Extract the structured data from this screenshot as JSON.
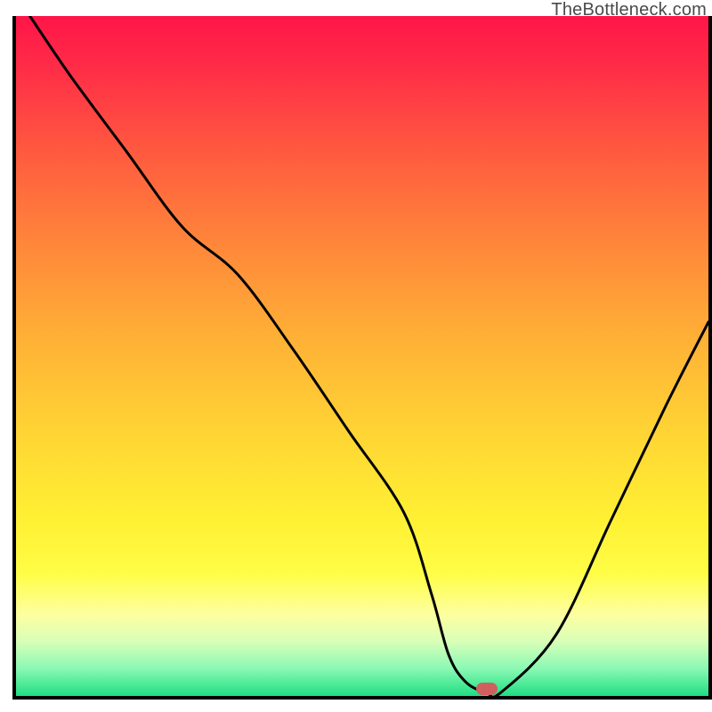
{
  "watermark": "TheBottleneck.com",
  "chart_data": {
    "type": "line",
    "title": "",
    "xlabel": "",
    "ylabel": "",
    "xlim": [
      0,
      100
    ],
    "ylim": [
      0,
      100
    ],
    "grid": false,
    "legend": false,
    "series": [
      {
        "name": "bottleneck-curve",
        "x": [
          2,
          8,
          16,
          24,
          32,
          40,
          48,
          56,
          60,
          62.5,
          65,
          68,
          70,
          78,
          86,
          94,
          100
        ],
        "y": [
          100,
          91,
          80,
          69,
          62,
          51,
          39,
          27,
          15,
          6,
          2,
          0.5,
          0.5,
          9,
          26,
          43,
          55
        ]
      }
    ],
    "marker": {
      "x": 68,
      "y": 1
    },
    "gradient_bands": [
      {
        "pos": 0,
        "color": "#ff1548"
      },
      {
        "pos": 8,
        "color": "#ff2e47"
      },
      {
        "pos": 20,
        "color": "#ff5a3f"
      },
      {
        "pos": 34,
        "color": "#ff883a"
      },
      {
        "pos": 48,
        "color": "#ffb236"
      },
      {
        "pos": 62,
        "color": "#ffd634"
      },
      {
        "pos": 74,
        "color": "#fff033"
      },
      {
        "pos": 82,
        "color": "#fffd46"
      },
      {
        "pos": 88,
        "color": "#fdffa0"
      },
      {
        "pos": 92,
        "color": "#d8ffb8"
      },
      {
        "pos": 96,
        "color": "#89f9b4"
      },
      {
        "pos": 100,
        "color": "#1fde83"
      }
    ]
  }
}
